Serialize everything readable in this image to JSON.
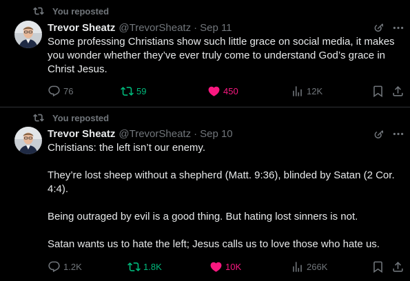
{
  "colors": {
    "background": "#000000",
    "text": "#e7e9ea",
    "muted": "#71767b",
    "retweet_active": "#00ba7c",
    "like_active": "#f91880",
    "divider": "#2f3336"
  },
  "tweets": [
    {
      "repost_label": "You reposted",
      "name": "Trevor Sheatz",
      "handle": "@TrevorSheatz",
      "separator": "·",
      "date": "Sep 11",
      "paragraphs": [
        "Some professing Christians show such little grace on social media, it makes you wonder whether they’ve ever truly come to understand God’s grace in Christ Jesus."
      ],
      "replies": "76",
      "retweets": "59",
      "likes": "450",
      "views": "12K"
    },
    {
      "repost_label": "You reposted",
      "name": "Trevor Sheatz",
      "handle": "@TrevorSheatz",
      "separator": "·",
      "date": "Sep 10",
      "paragraphs": [
        "Christians: the left isn’t our enemy.",
        "They’re lost sheep without a shepherd (Matt. 9:36), blinded by Satan (2 Cor. 4:4).",
        "Being outraged by evil is a good thing. But hating lost sinners is not.",
        "Satan wants us to hate the left; Jesus calls us to love those who hate us."
      ],
      "replies": "1.2K",
      "retweets": "1.8K",
      "likes": "10K",
      "views": "266K"
    }
  ],
  "icons": {
    "repost": "retweet-icon",
    "grok": "grok-icon",
    "more": "more-icon",
    "reply": "reply-icon",
    "retweet": "retweet-icon",
    "like": "heart-icon",
    "views": "views-icon",
    "bookmark": "bookmark-icon",
    "share": "share-icon"
  }
}
